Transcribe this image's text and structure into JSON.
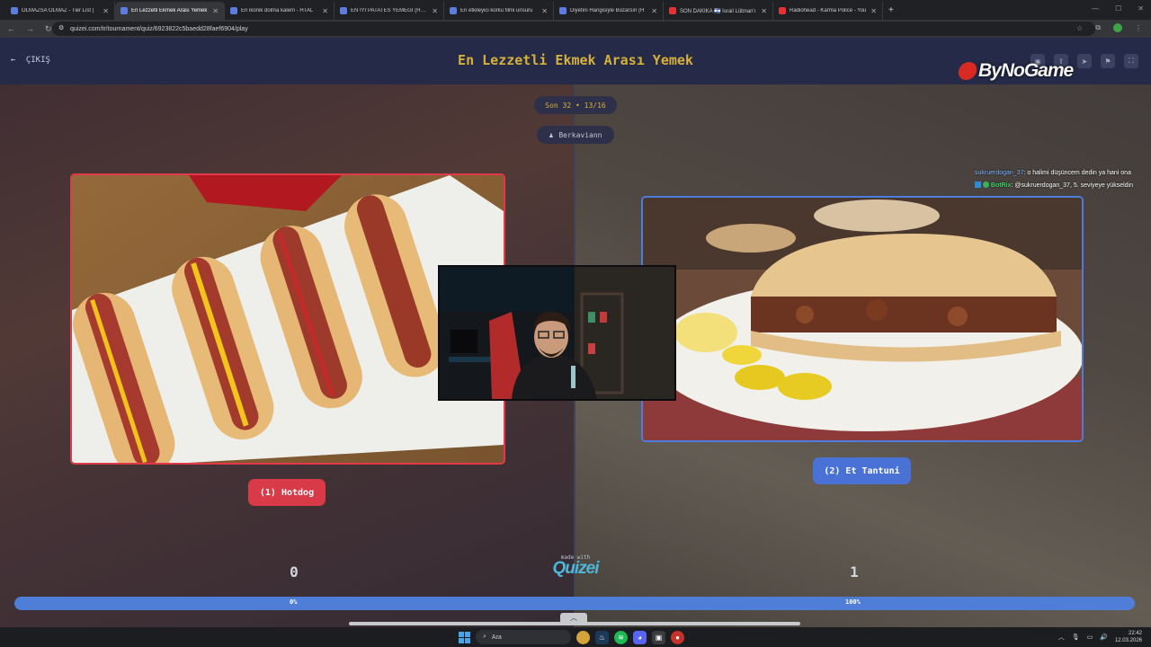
{
  "browser": {
    "tabs": [
      {
        "title": "OLMAZSA OLMAZ - Tier List |",
        "icon": "tierlist-icon",
        "active": false,
        "yt": false
      },
      {
        "title": "En Lezzetli Ekmek Arası Yemek",
        "icon": "quizei-icon",
        "active": true,
        "yt": false
      },
      {
        "title": "En ikonik dolma kalem - HTAL",
        "icon": "quizei-icon",
        "active": false,
        "yt": false
      },
      {
        "title": "EN İYİ PATATES YEMEĞİ (HTAL",
        "icon": "quizei-icon",
        "active": false,
        "yt": false
      },
      {
        "title": "En etkileyici korku filmi unsuru",
        "icon": "quizei-icon",
        "active": false,
        "yt": false
      },
      {
        "title": "Diyetini Hangisiyle Bozarsın (H",
        "icon": "quizei-icon",
        "active": false,
        "yt": false
      },
      {
        "title": "SON DAKİKA 🇮🇱 İsrail Lübnan'ı",
        "icon": "youtube-icon",
        "active": false,
        "yt": true
      },
      {
        "title": "Radiohead - Karma Police - You",
        "icon": "youtube-icon",
        "active": false,
        "yt": true
      }
    ],
    "url": "quizei.com/tr/tournament/quiz/6923822c5baedd28faef6904/play"
  },
  "header": {
    "exit_label": "ÇIKIŞ",
    "title": "En Lezzetli Ekmek Arası Yemek",
    "brand": "ByNoGame"
  },
  "match": {
    "round_label": "Son 32 • 13/16",
    "author": "Berkaviann",
    "left": {
      "label": "(1) Hotdog",
      "score": "0",
      "percent": "0%",
      "percent_value": 0
    },
    "right": {
      "label": "(2) Et Tantuni",
      "score": "1",
      "percent": "100%",
      "percent_value": 100
    }
  },
  "footer": {
    "made_with": "made with",
    "logo": "Quizei"
  },
  "chat": [
    {
      "user": "sukruerdogan_37",
      "text": ": o halimi düşüncem dedin ya hani ona"
    },
    {
      "user": "BotRix",
      "text": ": @sukruerdogan_37, 5. seviyeye yükseldin"
    }
  ],
  "taskbar": {
    "search_placeholder": "Ara",
    "time": "22:42",
    "date": "12.03.2026"
  },
  "colors": {
    "accent_gold": "#d6b13a",
    "left_red": "#d93a47",
    "right_blue": "#4a72d6"
  }
}
